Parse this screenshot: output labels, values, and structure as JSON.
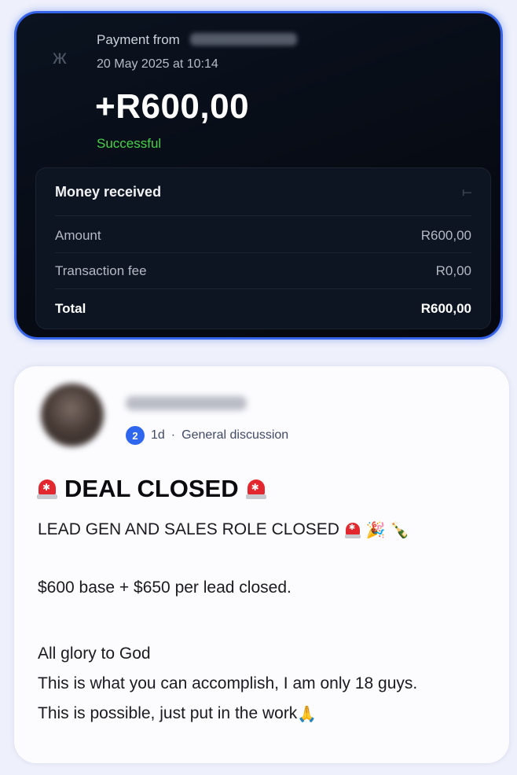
{
  "payment": {
    "from_label": "Payment from",
    "date": "20 May 2025 at 10:14",
    "amount": "+R600,00",
    "status": "Successful",
    "status_color": "#47d14a",
    "panel": {
      "title": "Money received",
      "rows": [
        {
          "label": "Amount",
          "value": "R600,00"
        },
        {
          "label": "Transaction fee",
          "value": "R0,00"
        },
        {
          "label": "Total",
          "value": "R600,00"
        }
      ]
    }
  },
  "post": {
    "level": "2",
    "time": "1d",
    "separator": "·",
    "category": "General discussion",
    "title": "DEAL CLOSED",
    "body": [
      "LEAD GEN AND SALES ROLE CLOSED",
      "$600 base + $650 per lead closed.",
      "All glory to God",
      "This is what you can accomplish, I am only 18 guys.",
      "This is possible, just put in the work"
    ],
    "emoji": {
      "party": "🎉",
      "bottle": "🍾",
      "pray": "🙏"
    }
  },
  "colors": {
    "accent_border": "#3563e9",
    "badge": "#2f66ee"
  }
}
